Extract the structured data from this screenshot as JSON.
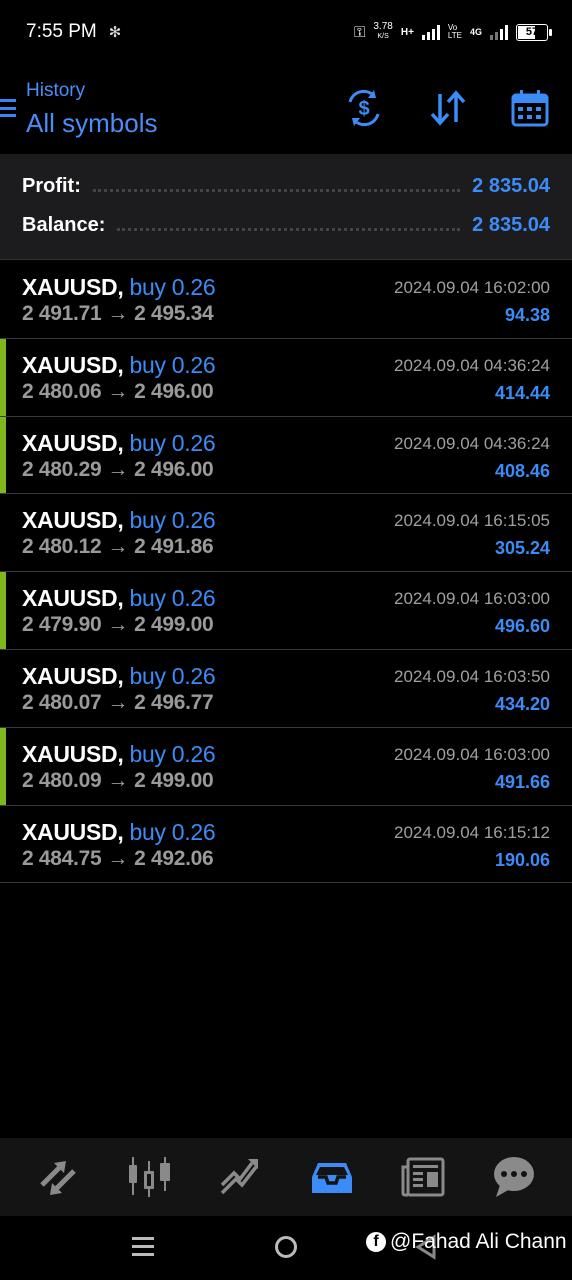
{
  "status_bar": {
    "time": "7:55 PM",
    "speed_value": "3.78",
    "speed_unit": "K/S",
    "network_left": "H+",
    "volte_top": "Vo",
    "volte_bottom": "LTE",
    "network_right": "4G",
    "battery": "57"
  },
  "header": {
    "subtitle": "History",
    "title": "All symbols"
  },
  "summary": {
    "profit_label": "Profit:",
    "profit_value": "2 835.04",
    "balance_label": "Balance:",
    "balance_value": "2 835.04"
  },
  "trades": [
    {
      "symbol": "XAUUSD,",
      "side": "buy 0.26",
      "open": "2 491.71",
      "arrow": "→",
      "close": "2 495.34",
      "time": "2024.09.04 16:02:00",
      "profit": "94.38",
      "accent": false
    },
    {
      "symbol": "XAUUSD,",
      "side": "buy 0.26",
      "open": "2 480.06",
      "arrow": "→",
      "close": "2 496.00",
      "time": "2024.09.04 04:36:24",
      "profit": "414.44",
      "accent": true
    },
    {
      "symbol": "XAUUSD,",
      "side": "buy 0.26",
      "open": "2 480.29",
      "arrow": "→",
      "close": "2 496.00",
      "time": "2024.09.04 04:36:24",
      "profit": "408.46",
      "accent": true
    },
    {
      "symbol": "XAUUSD,",
      "side": "buy 0.26",
      "open": "2 480.12",
      "arrow": "→",
      "close": "2 491.86",
      "time": "2024.09.04 16:15:05",
      "profit": "305.24",
      "accent": false
    },
    {
      "symbol": "XAUUSD,",
      "side": "buy 0.26",
      "open": "2 479.90",
      "arrow": "→",
      "close": "2 499.00",
      "time": "2024.09.04 16:03:00",
      "profit": "496.60",
      "accent": true
    },
    {
      "symbol": "XAUUSD,",
      "side": "buy 0.26",
      "open": "2 480.07",
      "arrow": "→",
      "close": "2 496.77",
      "time": "2024.09.04 16:03:50",
      "profit": "434.20",
      "accent": false
    },
    {
      "symbol": "XAUUSD,",
      "side": "buy 0.26",
      "open": "2 480.09",
      "arrow": "→",
      "close": "2 499.00",
      "time": "2024.09.04 16:03:00",
      "profit": "491.66",
      "accent": true
    },
    {
      "symbol": "XAUUSD,",
      "side": "buy 0.26",
      "open": "2 484.75",
      "arrow": "→",
      "close": "2 492.06",
      "time": "2024.09.04 16:15:12",
      "profit": "190.06",
      "accent": false
    }
  ],
  "bottom_nav": [
    {
      "icon": "quotes-icon",
      "active": false
    },
    {
      "icon": "chart-icon",
      "active": false
    },
    {
      "icon": "trade-icon",
      "active": false
    },
    {
      "icon": "history-icon",
      "active": true
    },
    {
      "icon": "news-icon",
      "active": false
    },
    {
      "icon": "chat-icon",
      "active": false
    }
  ],
  "watermark": "@Fahad Ali Chann",
  "colors": {
    "accent_blue": "#3b8cf6",
    "accent_green": "#7fb81d",
    "background": "#000000",
    "summary_bg": "#1c1c1e",
    "nav_bg": "#141414"
  }
}
